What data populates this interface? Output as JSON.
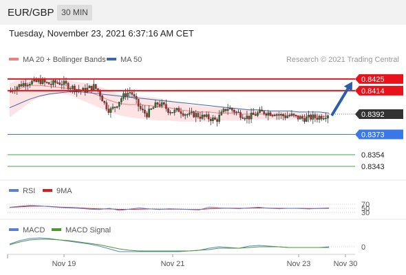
{
  "header": {
    "symbol": "EUR/GBP",
    "timeframe": "30 MIN",
    "datetime": "Tuesday, November 23, 2021 6:37:16 AM CET"
  },
  "legend": {
    "bollinger_label": "MA 20 + Bollinger Bands",
    "ma50_label": "MA 50",
    "copyright": "Research © 2021 Trading Central"
  },
  "rsi_panel": {
    "rsi_label": "RSI",
    "ma_label": "9MA",
    "levels": [
      "70",
      "50",
      "30"
    ]
  },
  "macd_panel": {
    "macd_label": "MACD",
    "signal_label": "MACD Signal",
    "zero_label": "0"
  },
  "colors": {
    "resistance": "#e8121a",
    "support": "#3b78e7",
    "target": "#3aa84b",
    "current": "#333333",
    "arrow": "#2a5ea8",
    "bollinger_fill": "#fde3e3",
    "ma20": "#f08080",
    "ma50": "#3a6aa8",
    "rsi": "#5b7fd6",
    "rsi_ma": "#d81c1c",
    "macd": "#5b7fd6",
    "macd_signal": "#4a9a2a"
  },
  "chart_data": [
    {
      "type": "candlestick",
      "title": "EUR/GBP",
      "timeframe": "30 MIN",
      "ylim": [
        0.8334,
        0.8432
      ],
      "x_tick_labels": [
        "Nov 19",
        "Nov 21",
        "Nov 23",
        "Nov 30"
      ],
      "last_price": 0.8392,
      "levels": [
        {
          "value": 0.8425,
          "label": "0.8425",
          "kind": "resistance"
        },
        {
          "value": 0.8414,
          "label": "0.8414",
          "kind": "resistance"
        },
        {
          "value": 0.8392,
          "label": "0.8392",
          "kind": "current"
        },
        {
          "value": 0.8373,
          "label": "0.8373",
          "kind": "support"
        },
        {
          "value": 0.8354,
          "label": "0.8354",
          "kind": "target"
        },
        {
          "value": 0.8343,
          "label": "0.8343",
          "kind": "target"
        }
      ],
      "price_path": [
        0.8413,
        0.8416,
        0.8419,
        0.8421,
        0.8422,
        0.8422,
        0.8423,
        0.8421,
        0.842,
        0.8422,
        0.8421,
        0.8419,
        0.8417,
        0.8415,
        0.8414,
        0.8416,
        0.8418,
        0.8413,
        0.8402,
        0.8395,
        0.8399,
        0.8406,
        0.8411,
        0.8413,
        0.8403,
        0.8395,
        0.8392,
        0.8397,
        0.8402,
        0.84,
        0.8396,
        0.8394,
        0.8396,
        0.8393,
        0.8391,
        0.8392,
        0.839,
        0.8389,
        0.8388,
        0.8386,
        0.8392,
        0.8398,
        0.8396,
        0.8393,
        0.8391,
        0.8389,
        0.8391,
        0.8393,
        0.8394,
        0.8393,
        0.8393,
        0.8391,
        0.839,
        0.8391,
        0.8389,
        0.8388,
        0.8388,
        0.8389,
        0.8389,
        0.839,
        0.8392
      ],
      "ma50": [
        0.8398,
        0.8402,
        0.8406,
        0.8409,
        0.8411,
        0.8412,
        0.8413,
        0.8413,
        0.8412,
        0.8411,
        0.841,
        0.8409,
        0.8408,
        0.8407,
        0.8406,
        0.8405,
        0.8404,
        0.8403,
        0.8402,
        0.8401,
        0.84,
        0.8399,
        0.8398,
        0.8397,
        0.8396,
        0.8396,
        0.8395,
        0.8395,
        0.8395,
        0.8394,
        0.8394,
        0.8394,
        0.8393
      ],
      "bollinger_mid": [
        0.8412,
        0.8416,
        0.8419,
        0.8419,
        0.8418,
        0.8417,
        0.8416,
        0.8415,
        0.8413,
        0.8409,
        0.8405,
        0.8402,
        0.8401,
        0.8401,
        0.84,
        0.8399,
        0.8398,
        0.8396,
        0.8395,
        0.8394,
        0.8394,
        0.8393,
        0.8393,
        0.8392,
        0.8392,
        0.8392,
        0.8392,
        0.8391,
        0.8391,
        0.839,
        0.839,
        0.839,
        0.839
      ],
      "bollinger_upper": [
        0.8421,
        0.8424,
        0.8426,
        0.8426,
        0.8425,
        0.8424,
        0.8423,
        0.8422,
        0.8421,
        0.8418,
        0.8414,
        0.8411,
        0.8409,
        0.8409,
        0.8408,
        0.8407,
        0.8405,
        0.8403,
        0.8401,
        0.84,
        0.8399,
        0.8399,
        0.8398,
        0.8397,
        0.8396,
        0.8396,
        0.8395,
        0.8395,
        0.8394,
        0.8394,
        0.8393,
        0.8393,
        0.8393
      ],
      "bollinger_lower": [
        0.8389,
        0.8396,
        0.8403,
        0.8408,
        0.841,
        0.8411,
        0.841,
        0.8406,
        0.8402,
        0.8398,
        0.8394,
        0.8391,
        0.8389,
        0.8388,
        0.8387,
        0.8386,
        0.8386,
        0.8385,
        0.8385,
        0.8385,
        0.8385,
        0.8386,
        0.8386,
        0.8386,
        0.8387,
        0.8387,
        0.8387,
        0.8387,
        0.8387,
        0.8387,
        0.8387,
        0.8387,
        0.8388
      ],
      "projection": {
        "from": 0.8392,
        "to": 0.8425
      }
    },
    {
      "type": "line",
      "title": "RSI",
      "ylim": [
        0,
        100
      ],
      "y_levels": [
        70,
        50,
        30
      ],
      "series": [
        {
          "name": "RSI",
          "values": [
            55,
            60,
            64,
            62,
            58,
            54,
            52,
            50,
            46,
            44,
            50,
            40,
            46,
            52,
            47,
            44,
            48,
            46,
            44,
            42,
            56,
            52,
            50,
            48,
            52,
            55,
            50,
            48,
            50,
            49,
            47,
            50,
            52
          ]
        },
        {
          "name": "9MA",
          "values": [
            54,
            57,
            60,
            61,
            59,
            56,
            54,
            52,
            49,
            47,
            47,
            45,
            45,
            46,
            47,
            46,
            46,
            46,
            45,
            44,
            48,
            50,
            51,
            50,
            51,
            52,
            51,
            50,
            50,
            50,
            49,
            49,
            50
          ]
        }
      ]
    },
    {
      "type": "line",
      "title": "MACD",
      "zero_line": 0,
      "series": [
        {
          "name": "MACD",
          "values": [
            4,
            9,
            12,
            13,
            12,
            10,
            8,
            6,
            4,
            1,
            -3,
            -7,
            -7,
            -7,
            -7,
            -7,
            -7,
            -7,
            -6,
            -5,
            -2,
            0,
            -1,
            -2,
            1,
            2,
            1,
            0,
            -1,
            -1,
            -1,
            -1,
            0
          ]
        },
        {
          "name": "MACD Signal",
          "values": [
            3,
            7,
            10,
            11,
            11,
            10,
            9,
            7,
            5,
            3,
            0,
            -3,
            -5,
            -6,
            -6,
            -6,
            -6,
            -6,
            -6,
            -5,
            -4,
            -2,
            -2,
            -2,
            -1,
            0,
            0,
            0,
            -1,
            -1,
            -1,
            -1,
            -1
          ]
        }
      ]
    }
  ]
}
